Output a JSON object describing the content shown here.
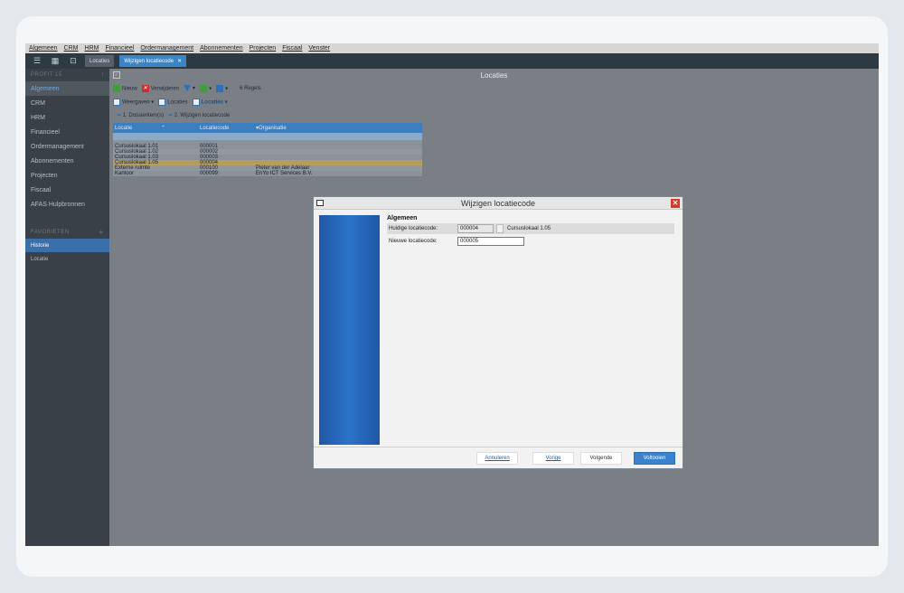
{
  "menu": [
    "Algemeen",
    "CRM",
    "HRM",
    "Financieel",
    "Ordermanagement",
    "Abonnementen",
    "Projecten",
    "Fiscaal",
    "Venster"
  ],
  "tabs": [
    "Locaties",
    "Wijzigen locatiecode"
  ],
  "sidebar": {
    "header": "PROFIT 15",
    "header_icon": "!",
    "items": [
      "Algemeen",
      "CRM",
      "HRM",
      "Financieel",
      "Ordermanagement",
      "Abonnementen",
      "Projecten",
      "Fiscaal",
      "AFAS Hulpbronnen"
    ],
    "favorites_header": "FAVORIETEN",
    "favorites_icon": "+",
    "history_label": "Historie",
    "history_items": [
      "Locatie"
    ]
  },
  "content": {
    "title": "Locaties",
    "actions": {
      "new": "Nieuw",
      "delete": "Verwijderen",
      "rows_count": "6 Regels",
      "views": "Weergaven",
      "locaties_1": "Locaties",
      "locaties_2": "Locaties",
      "step1": "1. Dossieritem(s)",
      "step2": "2. Wijzigen locatiecode"
    },
    "grid": {
      "columns": [
        "Locatie",
        "Locatiecode",
        "Organisatie"
      ],
      "rows": [
        [
          "Cursuslokaal 1.01",
          "000001",
          ""
        ],
        [
          "Cursuslokaal 1.02",
          "000002",
          ""
        ],
        [
          "Cursuslokaal 1.03",
          "000003",
          ""
        ],
        [
          "Cursuslokaal 1.05",
          "000004",
          ""
        ],
        [
          "Externe ruimte",
          "000100",
          "Pieter van der Adelaar"
        ],
        [
          "Kantoor",
          "000099",
          "EnYo ICT Services B.V."
        ]
      ]
    }
  },
  "dialog": {
    "title": "Wijzigen locatiecode",
    "section": "Algemeen",
    "current_label": "Huidige locatiecode:",
    "current_value": "000004",
    "current_desc": "Cursuslokaal 1.05",
    "new_label": "Nieuwe locatiecode:",
    "new_value": "000005",
    "buttons": {
      "cancel": "Annuleren",
      "prev": "Vorige",
      "next": "Volgende",
      "finish": "Voltooien"
    }
  },
  "colors": {
    "accent": "#3b82cc",
    "sidebar_bg": "#3a4047",
    "selected_row": "#b49d5e",
    "close": "#d33a2b"
  }
}
